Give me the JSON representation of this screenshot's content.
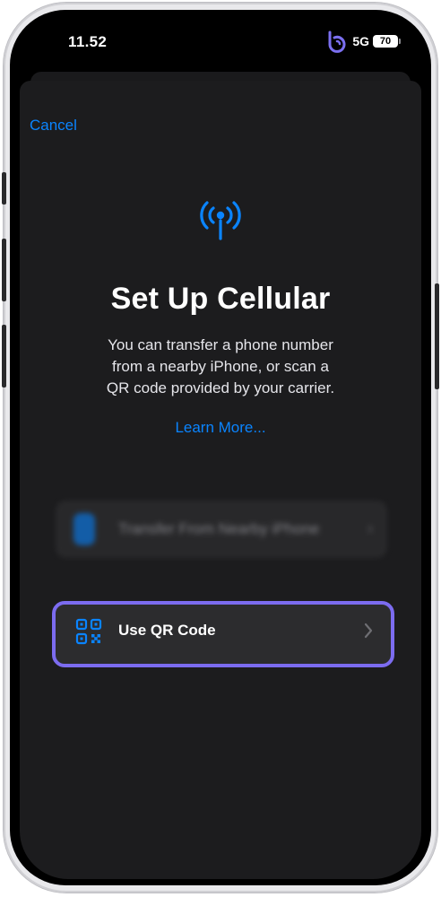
{
  "status_bar": {
    "time": "11.52",
    "network": "5G",
    "battery": "70"
  },
  "nav": {
    "cancel_label": "Cancel"
  },
  "header": {
    "icon": "cellular-antenna-icon",
    "title": "Set Up Cellular",
    "description": "You can transfer a phone number\nfrom a nearby iPhone, or scan a\nQR code provided by your carrier.",
    "learn_more_label": "Learn More..."
  },
  "options": [
    {
      "label": "Transfer From Nearby iPhone",
      "icon": "iphone-transfer-icon",
      "state": "blurred"
    },
    {
      "label": "Use QR Code",
      "icon": "qr-code-icon",
      "state": "highlighted"
    }
  ],
  "colors": {
    "accent": "#0a84ff",
    "highlight": "#7c6cf0",
    "sheet_background": "#1c1c1e",
    "row_background": "#2c2c2e"
  }
}
